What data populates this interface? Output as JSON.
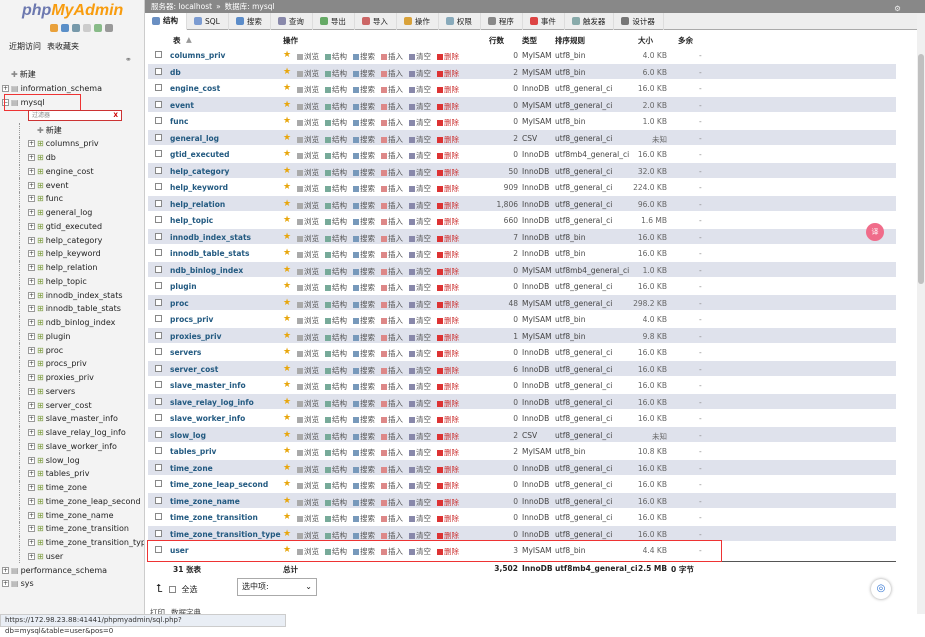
{
  "logo": {
    "part1": "php",
    "part2": "MyAdmin"
  },
  "left_links": {
    "recent": "近期访问",
    "favorites": "表收藏夹"
  },
  "filter_placeholder": "过滤器",
  "tree": [
    {
      "label": "新建",
      "level": 1,
      "type": "new"
    },
    {
      "label": "information_schema",
      "level": 1,
      "type": "db"
    },
    {
      "label": "mysql",
      "level": 1,
      "type": "db"
    },
    {
      "label": "新建",
      "level": 2,
      "type": "new"
    },
    {
      "label": "columns_priv",
      "level": 2,
      "type": "table"
    },
    {
      "label": "db",
      "level": 2,
      "type": "table"
    },
    {
      "label": "engine_cost",
      "level": 2,
      "type": "table"
    },
    {
      "label": "event",
      "level": 2,
      "type": "table"
    },
    {
      "label": "func",
      "level": 2,
      "type": "table"
    },
    {
      "label": "general_log",
      "level": 2,
      "type": "table"
    },
    {
      "label": "gtid_executed",
      "level": 2,
      "type": "table"
    },
    {
      "label": "help_category",
      "level": 2,
      "type": "table"
    },
    {
      "label": "help_keyword",
      "level": 2,
      "type": "table"
    },
    {
      "label": "help_relation",
      "level": 2,
      "type": "table"
    },
    {
      "label": "help_topic",
      "level": 2,
      "type": "table"
    },
    {
      "label": "innodb_index_stats",
      "level": 2,
      "type": "table"
    },
    {
      "label": "innodb_table_stats",
      "level": 2,
      "type": "table"
    },
    {
      "label": "ndb_binlog_index",
      "level": 2,
      "type": "table"
    },
    {
      "label": "plugin",
      "level": 2,
      "type": "table"
    },
    {
      "label": "proc",
      "level": 2,
      "type": "table"
    },
    {
      "label": "procs_priv",
      "level": 2,
      "type": "table"
    },
    {
      "label": "proxies_priv",
      "level": 2,
      "type": "table"
    },
    {
      "label": "servers",
      "level": 2,
      "type": "table"
    },
    {
      "label": "server_cost",
      "level": 2,
      "type": "table"
    },
    {
      "label": "slave_master_info",
      "level": 2,
      "type": "table"
    },
    {
      "label": "slave_relay_log_info",
      "level": 2,
      "type": "table"
    },
    {
      "label": "slave_worker_info",
      "level": 2,
      "type": "table"
    },
    {
      "label": "slow_log",
      "level": 2,
      "type": "table"
    },
    {
      "label": "tables_priv",
      "level": 2,
      "type": "table"
    },
    {
      "label": "time_zone",
      "level": 2,
      "type": "table"
    },
    {
      "label": "time_zone_leap_second",
      "level": 2,
      "type": "table"
    },
    {
      "label": "time_zone_name",
      "level": 2,
      "type": "table"
    },
    {
      "label": "time_zone_transition",
      "level": 2,
      "type": "table"
    },
    {
      "label": "time_zone_transition_type",
      "level": 2,
      "type": "table"
    },
    {
      "label": "user",
      "level": 2,
      "type": "table"
    },
    {
      "label": "performance_schema",
      "level": 1,
      "type": "db"
    },
    {
      "label": "sys",
      "level": 1,
      "type": "db"
    }
  ],
  "crumb": {
    "server": "服务器: localhost",
    "sep": "»",
    "database": "数据库: mysql"
  },
  "tabs": [
    {
      "label": "结构",
      "color": "#6a8fc2",
      "active": true
    },
    {
      "label": "SQL",
      "color": "#7b9bd1"
    },
    {
      "label": "搜索",
      "color": "#5b8cc9"
    },
    {
      "label": "查询",
      "color": "#88a"
    },
    {
      "label": "导出",
      "color": "#6a6"
    },
    {
      "label": "导入",
      "color": "#c66"
    },
    {
      "label": "操作",
      "color": "#d9a23a"
    },
    {
      "label": "权限",
      "color": "#8ab"
    },
    {
      "label": "程序",
      "color": "#888"
    },
    {
      "label": "事件",
      "color": "#d44"
    },
    {
      "label": "触发器",
      "color": "#8aa"
    },
    {
      "label": "设计器",
      "color": "#777"
    }
  ],
  "headers": {
    "table": "表",
    "sort": "▲",
    "action": "操作",
    "rows": "行数",
    "type": "类型",
    "collation": "排序规则",
    "size": "大小",
    "overhead": "多余"
  },
  "actions": {
    "browse": "浏览",
    "structure": "结构",
    "search": "搜索",
    "insert": "插入",
    "empty": "清空",
    "drop": "删除"
  },
  "rows": [
    {
      "name": "columns_priv",
      "rows": "0",
      "type": "MyISAM",
      "collation": "utf8_bin",
      "size": "4.0  KB",
      "overhead": "-"
    },
    {
      "name": "db",
      "rows": "2",
      "type": "MyISAM",
      "collation": "utf8_bin",
      "size": "6.0  KB",
      "overhead": "-"
    },
    {
      "name": "engine_cost",
      "rows": "0",
      "type": "InnoDB",
      "collation": "utf8_general_ci",
      "size": "16.0  KB",
      "overhead": "-"
    },
    {
      "name": "event",
      "rows": "0",
      "type": "MyISAM",
      "collation": "utf8_general_ci",
      "size": "2.0  KB",
      "overhead": "-"
    },
    {
      "name": "func",
      "rows": "0",
      "type": "MyISAM",
      "collation": "utf8_bin",
      "size": "1.0  KB",
      "overhead": "-"
    },
    {
      "name": "general_log",
      "rows": "2",
      "type": "CSV",
      "collation": "utf8_general_ci",
      "size": "未知",
      "overhead": "-"
    },
    {
      "name": "gtid_executed",
      "rows": "0",
      "type": "InnoDB",
      "collation": "utf8mb4_general_ci",
      "size": "16.0  KB",
      "overhead": "-"
    },
    {
      "name": "help_category",
      "rows": "50",
      "type": "InnoDB",
      "collation": "utf8_general_ci",
      "size": "32.0  KB",
      "overhead": "-"
    },
    {
      "name": "help_keyword",
      "rows": "909",
      "type": "InnoDB",
      "collation": "utf8_general_ci",
      "size": "224.0  KB",
      "overhead": "-"
    },
    {
      "name": "help_relation",
      "rows": "1,806",
      "type": "InnoDB",
      "collation": "utf8_general_ci",
      "size": "96.0  KB",
      "overhead": "-"
    },
    {
      "name": "help_topic",
      "rows": "660",
      "type": "InnoDB",
      "collation": "utf8_general_ci",
      "size": "1.6  MB",
      "overhead": "-"
    },
    {
      "name": "innodb_index_stats",
      "rows": "7",
      "type": "InnoDB",
      "collation": "utf8_bin",
      "size": "16.0  KB",
      "overhead": "-"
    },
    {
      "name": "innodb_table_stats",
      "rows": "2",
      "type": "InnoDB",
      "collation": "utf8_bin",
      "size": "16.0  KB",
      "overhead": "-"
    },
    {
      "name": "ndb_binlog_index",
      "rows": "0",
      "type": "MyISAM",
      "collation": "utf8mb4_general_ci",
      "size": "1.0  KB",
      "overhead": "-"
    },
    {
      "name": "plugin",
      "rows": "0",
      "type": "InnoDB",
      "collation": "utf8_general_ci",
      "size": "16.0  KB",
      "overhead": "-"
    },
    {
      "name": "proc",
      "rows": "48",
      "type": "MyISAM",
      "collation": "utf8_general_ci",
      "size": "298.2  KB",
      "overhead": "-"
    },
    {
      "name": "procs_priv",
      "rows": "0",
      "type": "MyISAM",
      "collation": "utf8_bin",
      "size": "4.0  KB",
      "overhead": "-"
    },
    {
      "name": "proxies_priv",
      "rows": "1",
      "type": "MyISAM",
      "collation": "utf8_bin",
      "size": "9.8  KB",
      "overhead": "-"
    },
    {
      "name": "servers",
      "rows": "0",
      "type": "InnoDB",
      "collation": "utf8_general_ci",
      "size": "16.0  KB",
      "overhead": "-"
    },
    {
      "name": "server_cost",
      "rows": "6",
      "type": "InnoDB",
      "collation": "utf8_general_ci",
      "size": "16.0  KB",
      "overhead": "-"
    },
    {
      "name": "slave_master_info",
      "rows": "0",
      "type": "InnoDB",
      "collation": "utf8_general_ci",
      "size": "16.0  KB",
      "overhead": "-"
    },
    {
      "name": "slave_relay_log_info",
      "rows": "0",
      "type": "InnoDB",
      "collation": "utf8_general_ci",
      "size": "16.0  KB",
      "overhead": "-"
    },
    {
      "name": "slave_worker_info",
      "rows": "0",
      "type": "InnoDB",
      "collation": "utf8_general_ci",
      "size": "16.0  KB",
      "overhead": "-"
    },
    {
      "name": "slow_log",
      "rows": "2",
      "type": "CSV",
      "collation": "utf8_general_ci",
      "size": "未知",
      "overhead": "-"
    },
    {
      "name": "tables_priv",
      "rows": "2",
      "type": "MyISAM",
      "collation": "utf8_bin",
      "size": "10.8  KB",
      "overhead": "-"
    },
    {
      "name": "time_zone",
      "rows": "0",
      "type": "InnoDB",
      "collation": "utf8_general_ci",
      "size": "16.0  KB",
      "overhead": "-"
    },
    {
      "name": "time_zone_leap_second",
      "rows": "0",
      "type": "InnoDB",
      "collation": "utf8_general_ci",
      "size": "16.0  KB",
      "overhead": "-"
    },
    {
      "name": "time_zone_name",
      "rows": "0",
      "type": "InnoDB",
      "collation": "utf8_general_ci",
      "size": "16.0  KB",
      "overhead": "-"
    },
    {
      "name": "time_zone_transition",
      "rows": "0",
      "type": "InnoDB",
      "collation": "utf8_general_ci",
      "size": "16.0  KB",
      "overhead": "-"
    },
    {
      "name": "time_zone_transition_type",
      "rows": "0",
      "type": "InnoDB",
      "collation": "utf8_general_ci",
      "size": "16.0  KB",
      "overhead": "-"
    },
    {
      "name": "user",
      "rows": "3",
      "type": "MyISAM",
      "collation": "utf8_bin",
      "size": "4.4  KB",
      "overhead": "-"
    }
  ],
  "summary": {
    "count": "31 张表",
    "total": "总计",
    "rows": "3,502",
    "type": "InnoDB",
    "collation": "utf8mb4_general_ci",
    "size": "2.5 MB",
    "overhead": "0 字节"
  },
  "checkall": {
    "label": "全选",
    "with_selected": "选中项:"
  },
  "footer": {
    "print": "打印",
    "dict": "数据字典"
  },
  "status_url": "https://172.98.23.88:41441/phpmyadmin/sql.php?db=mysql&table=user&pos=0",
  "float_icon": "◎",
  "pink_label": "译"
}
